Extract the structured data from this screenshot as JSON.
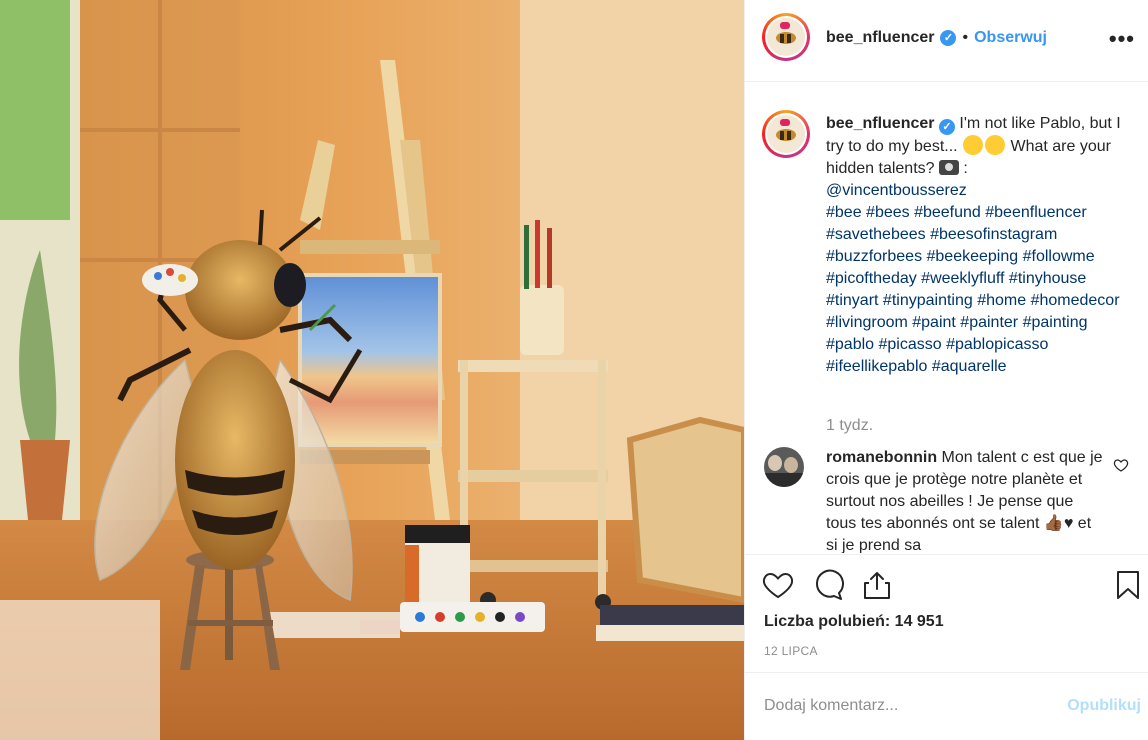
{
  "header": {
    "username": "bee_nfluencer",
    "separator": "•",
    "follow_label": "Obserwuj",
    "more_label": "•••",
    "verified_icon": "verified-badge-icon"
  },
  "caption": {
    "username": "bee_nfluencer",
    "text_a": " I'm not like Pablo, but I try to do my best... ",
    "text_b": " What are your hidden talents? ",
    "text_c": " : ",
    "mention": "@vincentbousserez",
    "hashtags": "#bee #bees #beefund #beenfluencer #savethebees #beesofinstagram #buzzforbees #beekeeping #followme #picoftheday #weeklyfluff #tinyhouse #tinyart #tinypainting #home #homedecor #livingroom #paint #painter #painting #pablo #picasso #pablopicasso #ifeellikepablo #aquarelle",
    "time_ago": "1 tydz."
  },
  "comment": {
    "username": "romanebonnin",
    "text": " Mon talent c est que je crois que je protège notre planète et surtout nos abeilles ! Je pense que tous tes abonnés ont se talent 👍🏾♥ et si je prend sa"
  },
  "actions": {
    "likes_label": "Liczba polubień: 14 951",
    "date": "12 LIPCA"
  },
  "add_comment": {
    "placeholder": "Dodaj komentarz...",
    "publish_label": "Opublikuj"
  },
  "colors": {
    "link_blue": "#3897f0",
    "hashtag": "#003569",
    "muted": "#8e8e8e",
    "publish_disabled": "#b2dffc"
  }
}
